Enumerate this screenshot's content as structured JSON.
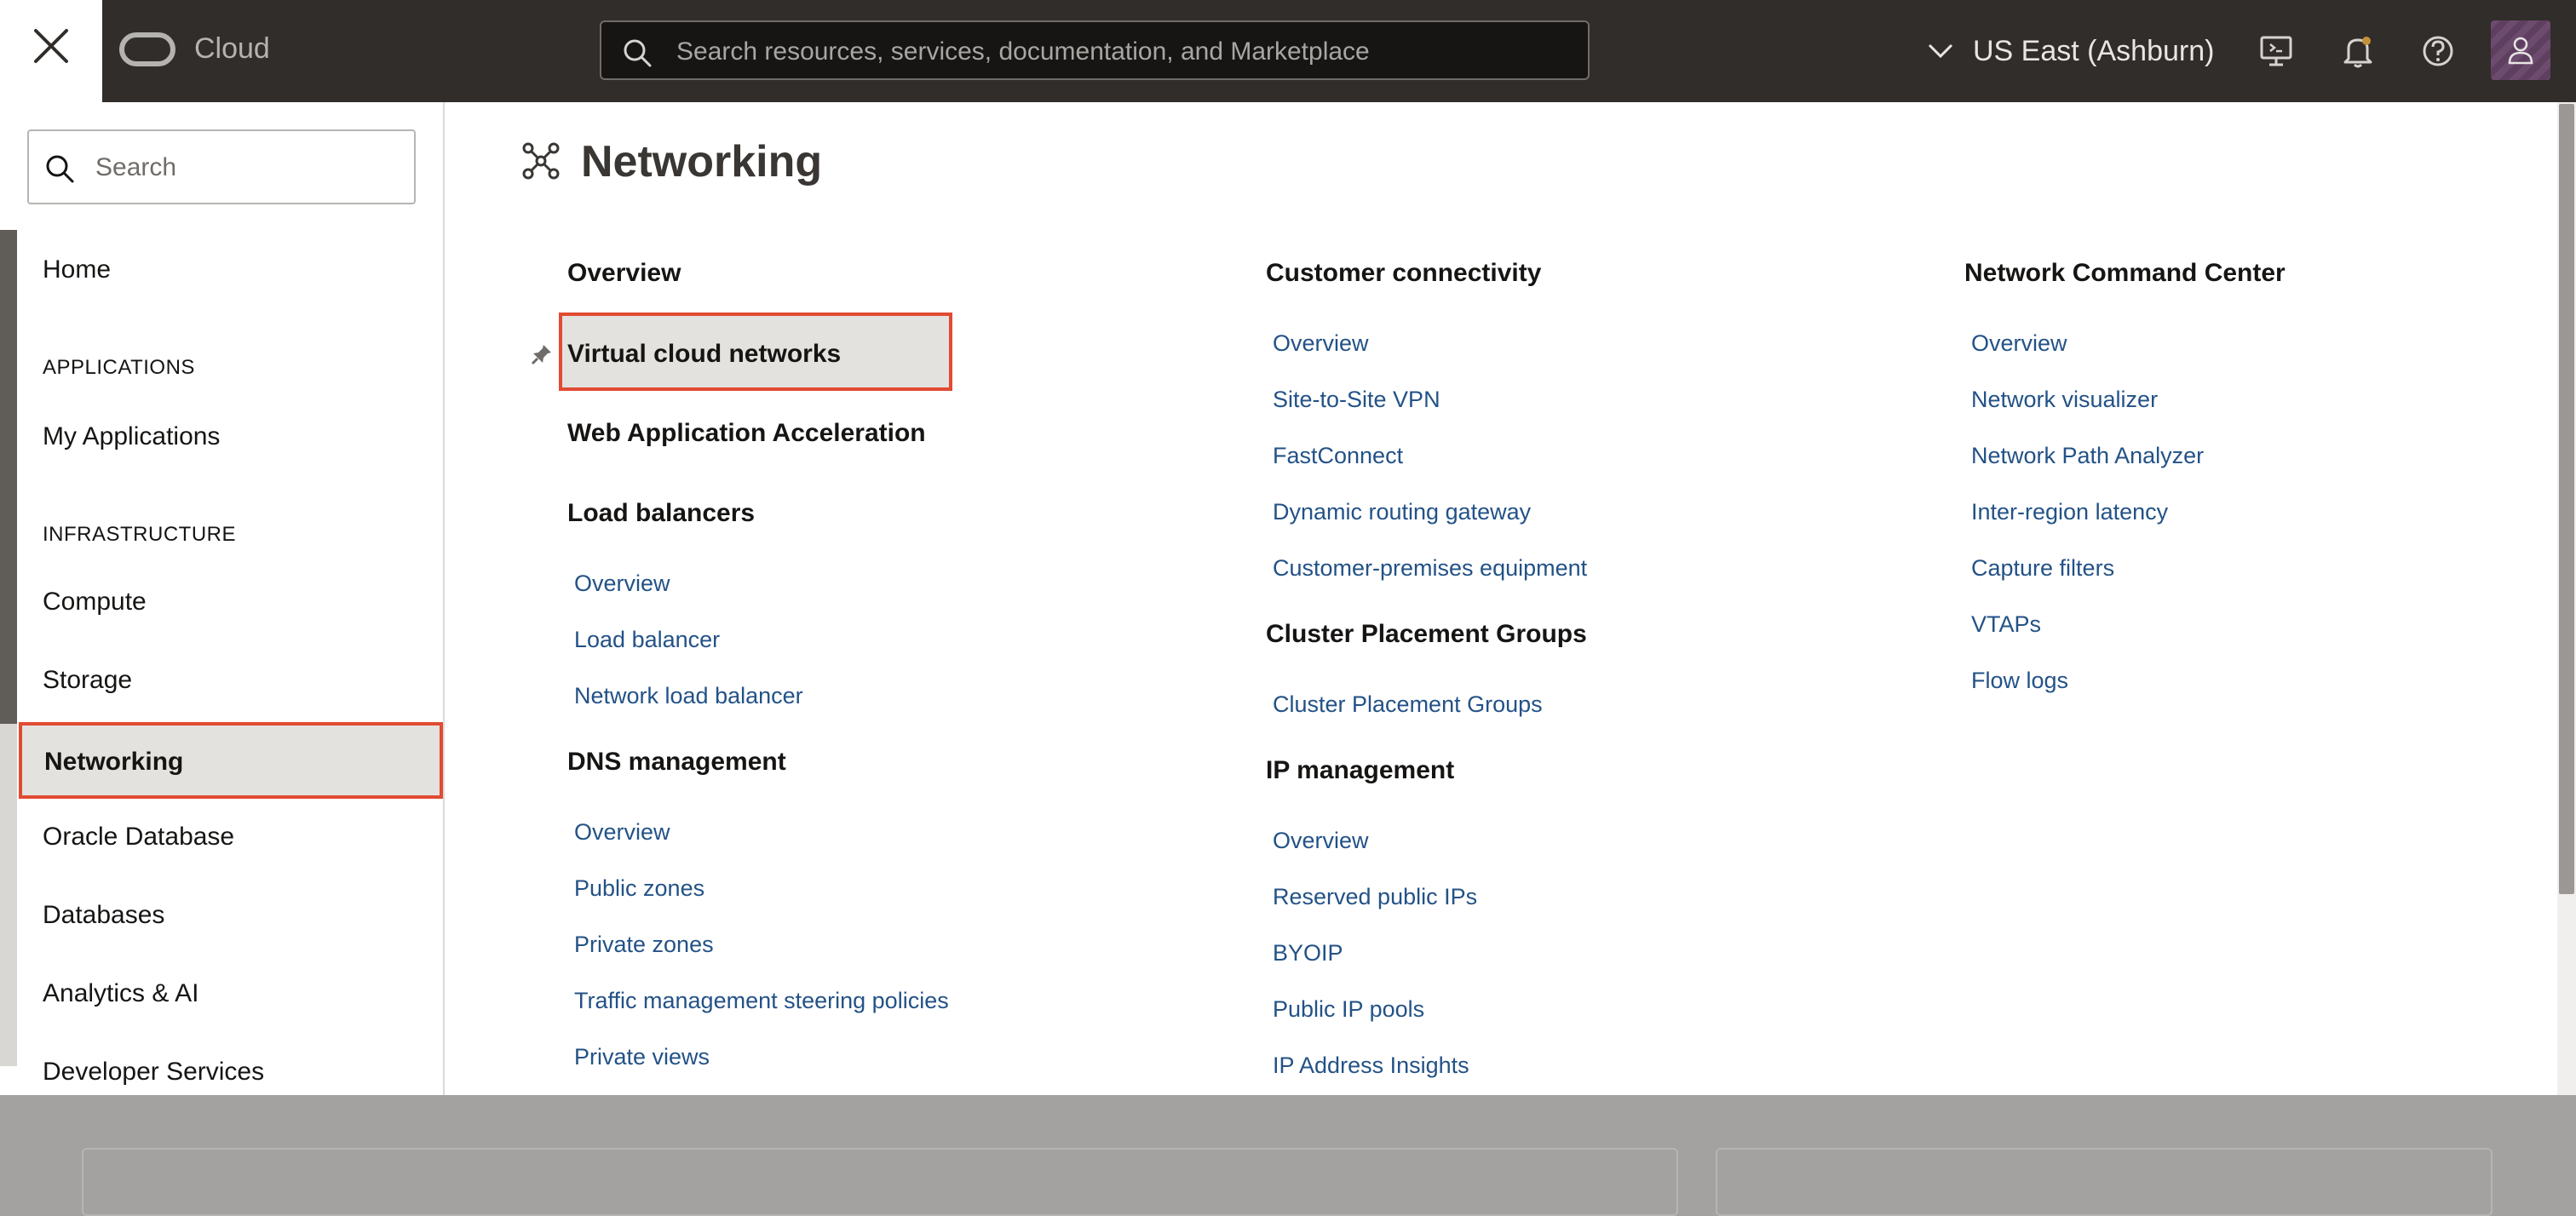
{
  "topbar": {
    "brand": "Cloud",
    "search_placeholder": "Search resources, services, documentation, and Marketplace",
    "region": "US East (Ashburn)"
  },
  "sidebar": {
    "search_placeholder": "Search",
    "items": [
      {
        "label": "Home"
      },
      {
        "heading": "APPLICATIONS"
      },
      {
        "label": "My Applications"
      },
      {
        "heading": "INFRASTRUCTURE"
      },
      {
        "label": "Compute"
      },
      {
        "label": "Storage"
      },
      {
        "label": "Networking",
        "active": true
      },
      {
        "label": "Oracle Database"
      },
      {
        "label": "Databases"
      },
      {
        "label": "Analytics & AI"
      },
      {
        "label": "Developer Services"
      }
    ]
  },
  "menu": {
    "title": "Networking",
    "col1": {
      "overview": "Overview",
      "vcn": "Virtual cloud networks",
      "waa": "Web Application Acceleration",
      "lb_heading": "Load balancers",
      "lb_links": [
        "Overview",
        "Load balancer",
        "Network load balancer"
      ],
      "dns_heading": "DNS management",
      "dns_links": [
        "Overview",
        "Public zones",
        "Private zones",
        "Traffic management steering policies",
        "Private views"
      ]
    },
    "col2": {
      "cc_heading": "Customer connectivity",
      "cc_links": [
        "Overview",
        "Site-to-Site VPN",
        "FastConnect",
        "Dynamic routing gateway",
        "Customer-premises equipment"
      ],
      "cpg_heading": "Cluster Placement Groups",
      "cpg_links": [
        "Cluster Placement Groups"
      ],
      "ip_heading": "IP management",
      "ip_links": [
        "Overview",
        "Reserved public IPs",
        "BYOIP",
        "Public IP pools",
        "IP Address Insights"
      ]
    },
    "col3": {
      "ncc_heading": "Network Command Center",
      "ncc_links": [
        "Overview",
        "Network visualizer",
        "Network Path Analyzer",
        "Inter-region latency",
        "Capture filters",
        "VTAPs",
        "Flow logs"
      ]
    }
  },
  "colors": {
    "topbar": "#312d2a",
    "link": "#235287",
    "highlight_border": "#e14b32",
    "active_bg": "#e4e2df"
  }
}
